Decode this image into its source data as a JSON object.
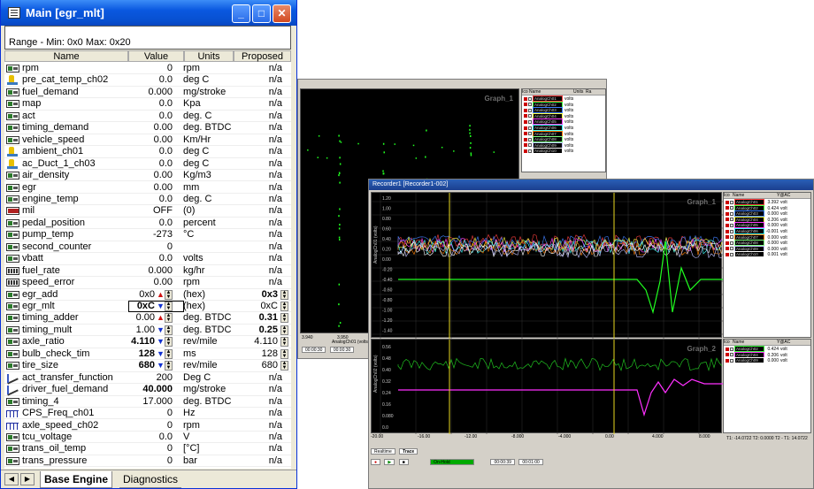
{
  "main": {
    "title": "Main [egr_mlt]",
    "range_text": "Range -  Min: 0x0   Max: 0x20",
    "headers": {
      "name": "Name",
      "value": "Value",
      "units": "Units",
      "proposed": "Proposed"
    },
    "rows": [
      {
        "icon": "std",
        "name": "rpm",
        "value": "0",
        "units": "rpm",
        "proposed": "n/a"
      },
      {
        "icon": "temp",
        "name": "pre_cat_temp_ch02",
        "value": "0.0",
        "units": "deg C",
        "proposed": "n/a"
      },
      {
        "icon": "std",
        "name": "fuel_demand",
        "value": "0.000",
        "units": "mg/stroke",
        "proposed": "n/a"
      },
      {
        "icon": "std",
        "name": "map",
        "value": "0.0",
        "units": "Kpa",
        "proposed": "n/a"
      },
      {
        "icon": "std",
        "name": "act",
        "value": "0.0",
        "units": "deg. C",
        "proposed": "n/a"
      },
      {
        "icon": "std",
        "name": "timing_demand",
        "value": "0.00",
        "units": "deg. BTDC",
        "proposed": "n/a"
      },
      {
        "icon": "std",
        "name": "vehicle_speed",
        "value": "0.00",
        "units": "Km/Hr",
        "proposed": "n/a"
      },
      {
        "icon": "temp",
        "name": "ambient_ch01",
        "value": "0.0",
        "units": "deg C",
        "proposed": "n/a"
      },
      {
        "icon": "temp",
        "name": "ac_Duct_1_ch03",
        "value": "0.0",
        "units": "deg C",
        "proposed": "n/a"
      },
      {
        "icon": "std",
        "name": "air_density",
        "value": "0.00",
        "units": "Kg/m3",
        "proposed": "n/a"
      },
      {
        "icon": "std",
        "name": "egr",
        "value": "0.00",
        "units": "mm",
        "proposed": "n/a"
      },
      {
        "icon": "std",
        "name": "engine_temp",
        "value": "0.0",
        "units": "deg. C",
        "proposed": "n/a"
      },
      {
        "icon": "mil",
        "name": "mil",
        "value": "OFF",
        "units": "(0)",
        "proposed": "n/a"
      },
      {
        "icon": "std",
        "name": "pedal_position",
        "value": "0.0",
        "units": "percent",
        "proposed": "n/a"
      },
      {
        "icon": "std",
        "name": "pump_temp",
        "value": "-273",
        "units": "°C",
        "proposed": "n/a"
      },
      {
        "icon": "std",
        "name": "second_counter",
        "value": "0",
        "units": "",
        "proposed": "n/a"
      },
      {
        "icon": "std",
        "name": "vbatt",
        "value": "0.0",
        "units": "volts",
        "proposed": "n/a"
      },
      {
        "icon": "calc",
        "name": "fuel_rate",
        "value": "0.000",
        "units": "kg/hr",
        "proposed": "n/a"
      },
      {
        "icon": "calc",
        "name": "speed_error",
        "value": "0.00",
        "units": "rpm",
        "proposed": "n/a"
      },
      {
        "icon": "std",
        "name": "egr_add",
        "value": "0x0",
        "units": "(hex)",
        "proposed": "0x3",
        "arrow": "up",
        "spin": true,
        "bold_prop": true
      },
      {
        "icon": "std",
        "name": "egr_mlt",
        "value": "0xC",
        "units": "(hex)",
        "proposed": "0xC",
        "arrow": "dn",
        "spin": true,
        "edit": true,
        "bold_val": true
      },
      {
        "icon": "std",
        "name": "timing_adder",
        "value": "0.00",
        "units": "deg. BTDC",
        "proposed": "0.31",
        "arrow": "up",
        "spin": true,
        "bold_prop": true
      },
      {
        "icon": "std",
        "name": "timing_mult",
        "value": "1.00",
        "units": "deg. BTDC",
        "proposed": "0.25",
        "arrow": "dn",
        "spin": true,
        "bold_prop": true
      },
      {
        "icon": "std",
        "name": "axle_ratio",
        "value": "4.110",
        "units": "rev/mile",
        "proposed": "4.110",
        "arrow": "dn",
        "spin": true,
        "bold_val": true
      },
      {
        "icon": "std",
        "name": "bulb_check_tim",
        "value": "128",
        "units": "ms",
        "proposed": "128",
        "arrow": "dn",
        "spin": true,
        "bold_val": true
      },
      {
        "icon": "std",
        "name": "tire_size",
        "value": "680",
        "units": "rev/mile",
        "proposed": "680",
        "arrow": "dn",
        "spin": true,
        "bold_val": true
      },
      {
        "icon": "chart",
        "name": "act_transfer_function",
        "value": "200",
        "units": "Deg C",
        "proposed": "n/a"
      },
      {
        "icon": "chart",
        "name": "driver_fuel_demand",
        "value": "40.000",
        "units": "mg/stroke",
        "proposed": "n/a",
        "bold_val": true
      },
      {
        "icon": "std",
        "name": "timing_4",
        "value": "17.000",
        "units": "deg. BTDC",
        "proposed": "n/a"
      },
      {
        "icon": "freq",
        "name": "CPS_Freq_ch01",
        "value": "0",
        "units": "Hz",
        "proposed": "n/a"
      },
      {
        "icon": "freq",
        "name": "axle_speed_ch02",
        "value": "0",
        "units": "rpm",
        "proposed": "n/a"
      },
      {
        "icon": "std",
        "name": "tcu_voltage",
        "value": "0.0",
        "units": "V",
        "proposed": "n/a"
      },
      {
        "icon": "std",
        "name": "trans_oil_temp",
        "value": "0",
        "units": "[°C]",
        "proposed": "n/a"
      },
      {
        "icon": "std",
        "name": "trans_pressure",
        "value": "0",
        "units": "bar",
        "proposed": "n/a"
      }
    ],
    "tabs": [
      "Base Engine",
      "Diagnostics"
    ]
  },
  "scope1": {
    "graph_label": "Graph_1",
    "xlabels": [
      "3.940",
      "3.950",
      "AnalogCh01 (volts)"
    ],
    "time_fields": [
      "00:00:30",
      "00:00:30"
    ],
    "legend_headers": [
      "Ico",
      "Name",
      "Units",
      "Ra"
    ],
    "channels": [
      "AnalogCh01",
      "AnalogCh02",
      "AnalogCh03",
      "AnalogCh04",
      "AnalogCh05",
      "AnalogCh06",
      "AnalogCh07",
      "AnalogCh08",
      "AnalogCh09",
      "AnalogCh10"
    ],
    "unit": "volts"
  },
  "scope2": {
    "title": "Recorder1 [Recorder1-002]",
    "graph1_label": "Graph_1",
    "graph2_label": "Graph_2",
    "yaxis1": "AnalogCh01 (volts)",
    "yaxis2": "AnalogCh02 (volts)",
    "yticks1": [
      "1.20",
      "1.00",
      "0.80",
      "0.60",
      "0.40",
      "0.20",
      "0.00",
      "-0.20",
      "-0.40",
      "-0.60",
      "-0.80",
      "-1.00",
      "-1.20",
      "-1.40"
    ],
    "yticks2": [
      "0.56",
      "0.48",
      "0.40",
      "0.32",
      "0.24",
      "0.16",
      "0.080",
      "0.0"
    ],
    "xticks": [
      "-20.00",
      "-16.00",
      "-12.00",
      "-8.000",
      "-4.000",
      "0.00",
      "4.000",
      "8.000"
    ],
    "legend_headers": [
      "Ico",
      "Name",
      "Y@AC"
    ],
    "legend1": [
      {
        "name": "AnalogCh01",
        "val": "3.392",
        "unit": "volt"
      },
      {
        "name": "AnalogCh02",
        "val": "0.424",
        "unit": "volt"
      },
      {
        "name": "AnalogCh03",
        "val": "0.000",
        "unit": "volt"
      },
      {
        "name": "AnalogCh04",
        "val": "0.206",
        "unit": "volt"
      },
      {
        "name": "AnalogCh05",
        "val": "0.000",
        "unit": "volt"
      },
      {
        "name": "AnalogCh06",
        "val": "-0.001",
        "unit": "volt"
      },
      {
        "name": "AnalogCh07",
        "val": "0.000",
        "unit": "volt"
      },
      {
        "name": "AnalogCh08",
        "val": "0.000",
        "unit": "volt"
      },
      {
        "name": "AnalogCh09",
        "val": "0.000",
        "unit": "volt"
      },
      {
        "name": "AnalogCh10",
        "val": "0.001",
        "unit": "volt"
      }
    ],
    "legend2": [
      {
        "name": "AnalogCh02",
        "val": "0.424",
        "unit": "volt"
      },
      {
        "name": "AnalogCh04",
        "val": "0.206",
        "unit": "volt"
      },
      {
        "name": "AnalogCh09",
        "val": "0.000",
        "unit": "volt"
      }
    ],
    "tabs": [
      "Realtime",
      "Trace"
    ],
    "status": {
      "state": "On-Hold",
      "t1": "00:00:39",
      "t2": "00:01:00"
    },
    "readout": "T1: -14.0722  T2: 0.0000  T2 - T1: 14.0722"
  },
  "colors": {
    "xp_blue": "#0a58e0",
    "trace_green": "#10e010",
    "trace_magenta": "#ff20ff",
    "cursor_yellow": "#e8d820"
  }
}
